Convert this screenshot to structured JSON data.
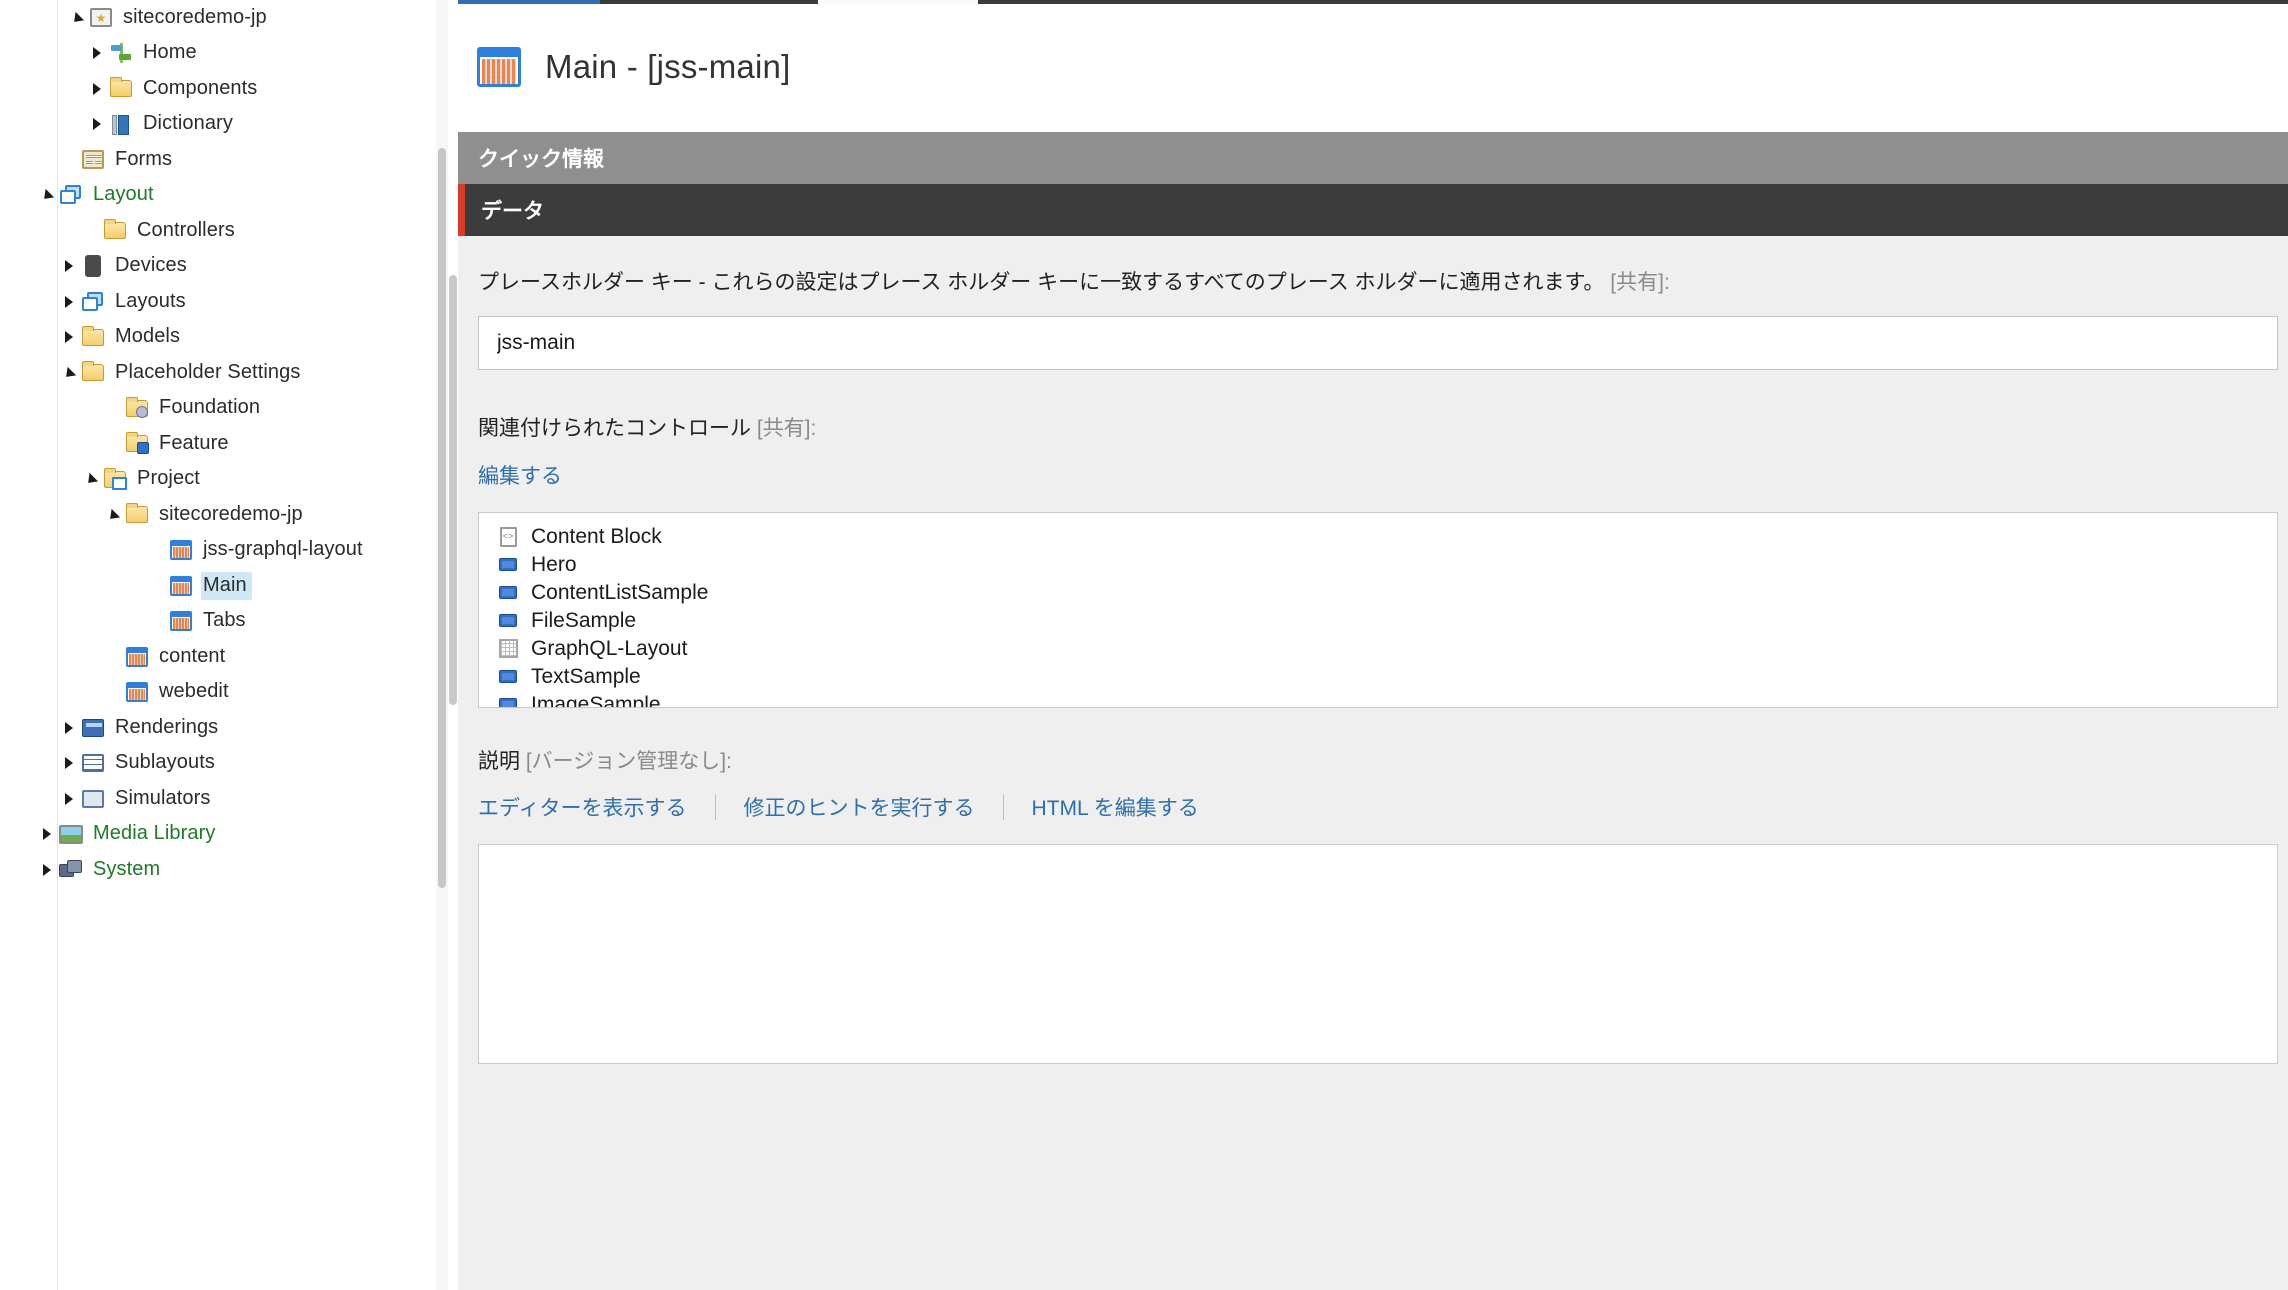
{
  "tree": {
    "items": [
      {
        "label": "sitecoredemo-jp",
        "icon": "site-folder-icon",
        "indent": 88,
        "twisty": "down",
        "selected": false,
        "green": false
      },
      {
        "label": "Home",
        "icon": "signpost-icon",
        "indent": 108,
        "twisty": "right",
        "selected": false,
        "green": false
      },
      {
        "label": "Components",
        "icon": "folder-icon",
        "indent": 108,
        "twisty": "right",
        "selected": false,
        "green": false
      },
      {
        "label": "Dictionary",
        "icon": "book-icon",
        "indent": 108,
        "twisty": "right",
        "selected": false,
        "green": false
      },
      {
        "label": "Forms",
        "icon": "forms-icon",
        "indent": 80,
        "twisty": "none",
        "selected": false,
        "green": false
      },
      {
        "label": "Layout",
        "icon": "layout-icon",
        "indent": 58,
        "twisty": "down",
        "selected": false,
        "green": true
      },
      {
        "label": "Controllers",
        "icon": "folder-icon",
        "indent": 102,
        "twisty": "none",
        "selected": false,
        "green": false
      },
      {
        "label": "Devices",
        "icon": "device-icon",
        "indent": 80,
        "twisty": "right",
        "selected": false,
        "green": false
      },
      {
        "label": "Layouts",
        "icon": "layout-icon",
        "indent": 80,
        "twisty": "right",
        "selected": false,
        "green": false
      },
      {
        "label": "Models",
        "icon": "folder-icon",
        "indent": 80,
        "twisty": "right",
        "selected": false,
        "green": false
      },
      {
        "label": "Placeholder Settings",
        "icon": "folder-icon",
        "indent": 80,
        "twisty": "down",
        "selected": false,
        "green": false
      },
      {
        "label": "Foundation",
        "icon": "folder-gear-icon",
        "indent": 124,
        "twisty": "none",
        "selected": false,
        "green": false
      },
      {
        "label": "Feature",
        "icon": "folder-cubes-icon",
        "indent": 124,
        "twisty": "none",
        "selected": false,
        "green": false
      },
      {
        "label": "Project",
        "icon": "folder-blue-icon",
        "indent": 102,
        "twisty": "down",
        "selected": false,
        "green": false
      },
      {
        "label": "sitecoredemo-jp",
        "icon": "folder-icon",
        "indent": 124,
        "twisty": "down",
        "selected": false,
        "green": false
      },
      {
        "label": "jss-graphql-layout",
        "icon": "placeholder-item-icon",
        "indent": 168,
        "twisty": "none",
        "selected": false,
        "green": false
      },
      {
        "label": "Main",
        "icon": "placeholder-item-icon",
        "indent": 168,
        "twisty": "none",
        "selected": true,
        "green": false
      },
      {
        "label": "Tabs",
        "icon": "placeholder-item-icon",
        "indent": 168,
        "twisty": "none",
        "selected": false,
        "green": false
      },
      {
        "label": "content",
        "icon": "placeholder-item-icon",
        "indent": 124,
        "twisty": "none",
        "selected": false,
        "green": false
      },
      {
        "label": "webedit",
        "icon": "placeholder-item-icon",
        "indent": 124,
        "twisty": "none",
        "selected": false,
        "green": false
      },
      {
        "label": "Renderings",
        "icon": "renderings-icon",
        "indent": 80,
        "twisty": "right",
        "selected": false,
        "green": false
      },
      {
        "label": "Sublayouts",
        "icon": "sublayouts-icon",
        "indent": 80,
        "twisty": "right",
        "selected": false,
        "green": false
      },
      {
        "label": "Simulators",
        "icon": "simulators-icon",
        "indent": 80,
        "twisty": "right",
        "selected": false,
        "green": false
      },
      {
        "label": "Media Library",
        "icon": "media-library-icon",
        "indent": 58,
        "twisty": "right",
        "selected": false,
        "green": true
      },
      {
        "label": "System",
        "icon": "system-icon",
        "indent": 58,
        "twisty": "right",
        "selected": false,
        "green": true
      }
    ]
  },
  "header": {
    "title": "Main - [jss-main]",
    "icon": "placeholder-item-icon"
  },
  "sections": {
    "quick_info": "クイック情報",
    "data": "データ"
  },
  "fields": {
    "placeholder_key": {
      "label": "プレースホルダー キー - これらの設定はプレース ホルダー キーに一致するすべてのプレース ホルダーに適用されます。",
      "shared": "[共有]:",
      "value": "jss-main",
      "placeholder": ""
    },
    "associated_controls": {
      "label": "関連付けられたコントロール",
      "shared": "[共有]:",
      "edit_link": "編集する",
      "items": [
        {
          "name": "Content Block",
          "icon": "document-code-icon"
        },
        {
          "name": "Hero",
          "icon": "rendering-icon"
        },
        {
          "name": "ContentListSample",
          "icon": "rendering-icon"
        },
        {
          "name": "FileSample",
          "icon": "rendering-icon"
        },
        {
          "name": "GraphQL-Layout",
          "icon": "grid-icon"
        },
        {
          "name": "TextSample",
          "icon": "rendering-icon"
        },
        {
          "name": "ImageSample",
          "icon": "rendering-icon"
        }
      ]
    },
    "description": {
      "label": "説明",
      "versioning": "[バージョン管理なし]:",
      "links": [
        "エディターを表示する",
        "修正のヒントを実行する",
        "HTML を編集する"
      ]
    }
  },
  "colors": {
    "accent_red": "#d93b28",
    "link_blue": "#2b6fb0",
    "selection_blue": "#cfe8f5",
    "data_bar": "#3c3c3c",
    "quickinfo_bar": "#8f8f8f"
  }
}
